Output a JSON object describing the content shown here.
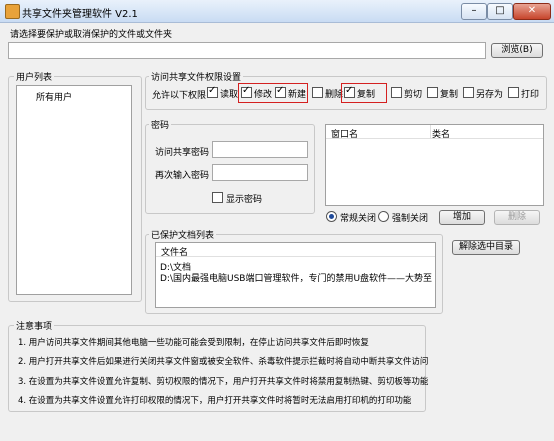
{
  "window": {
    "title": "共享文件夹管理软件 V2.1",
    "controls": {
      "minimize": "–",
      "maximize": "□",
      "close": "✕"
    }
  },
  "select": {
    "prompt": "请选择要保护或取消保护的文件或文件夹",
    "path_value": "",
    "browse_label": "浏览(B)"
  },
  "users": {
    "group_label": "用户列表",
    "items": [
      "所有用户"
    ]
  },
  "permissions": {
    "group_label": "访问共享文件权限设置",
    "allow_label": "允许以下权限",
    "items": [
      {
        "label": "读取",
        "checked": true,
        "highlight": false
      },
      {
        "label": "修改",
        "checked": true,
        "highlight": true
      },
      {
        "label": "新建",
        "checked": true,
        "highlight": true
      },
      {
        "label": "删除",
        "checked": false,
        "highlight": false
      },
      {
        "label": "复制",
        "checked": true,
        "highlight": true
      },
      {
        "label": "剪切",
        "checked": false,
        "highlight": false
      },
      {
        "label": "复制",
        "checked": false,
        "highlight": false
      },
      {
        "label": "另存为",
        "checked": false,
        "highlight": false
      },
      {
        "label": "打印",
        "checked": false,
        "highlight": false
      }
    ]
  },
  "password": {
    "group_label": "密码",
    "access_label": "访问共享密码",
    "access_value": "",
    "confirm_label": "再次输入密码",
    "confirm_value": "",
    "show_label": "显示密码",
    "show_checked": false
  },
  "windows_list": {
    "columns": [
      "窗口名",
      "类名"
    ],
    "rows": []
  },
  "close_mode": {
    "options": [
      "常规关闭",
      "强制关闭"
    ],
    "selected": 0,
    "add_label": "增加",
    "delete_label": "删除"
  },
  "protected": {
    "group_label": "已保护文档列表",
    "column": "文件名",
    "rows": [
      "D:\\文档",
      "D:\\国内最强电脑USB端口管理软件，专门的禁用U盘软件——大势至USB端..."
    ],
    "remove_label": "解除选中目录"
  },
  "notes": {
    "group_label": "注意事项",
    "items": [
      "1. 用户访问共享文件期间其他电脑一些功能可能会受到限制，在停止访问共享文件后即时恢复",
      "2. 用户打开共享文件后如果进行关闭共享文件窗或被安全软件、杀毒软件提示拦截时将自动中断共享文件访问",
      "3. 在设置为共享文件设置允许复制、剪切权限的情况下，用户打开共享文件时将禁用复制热键、剪切板等功能",
      "4. 在设置为共享文件设置允许打印权限的情况下，用户打开共享文件时将暂时无法启用打印机的打印功能"
    ]
  }
}
